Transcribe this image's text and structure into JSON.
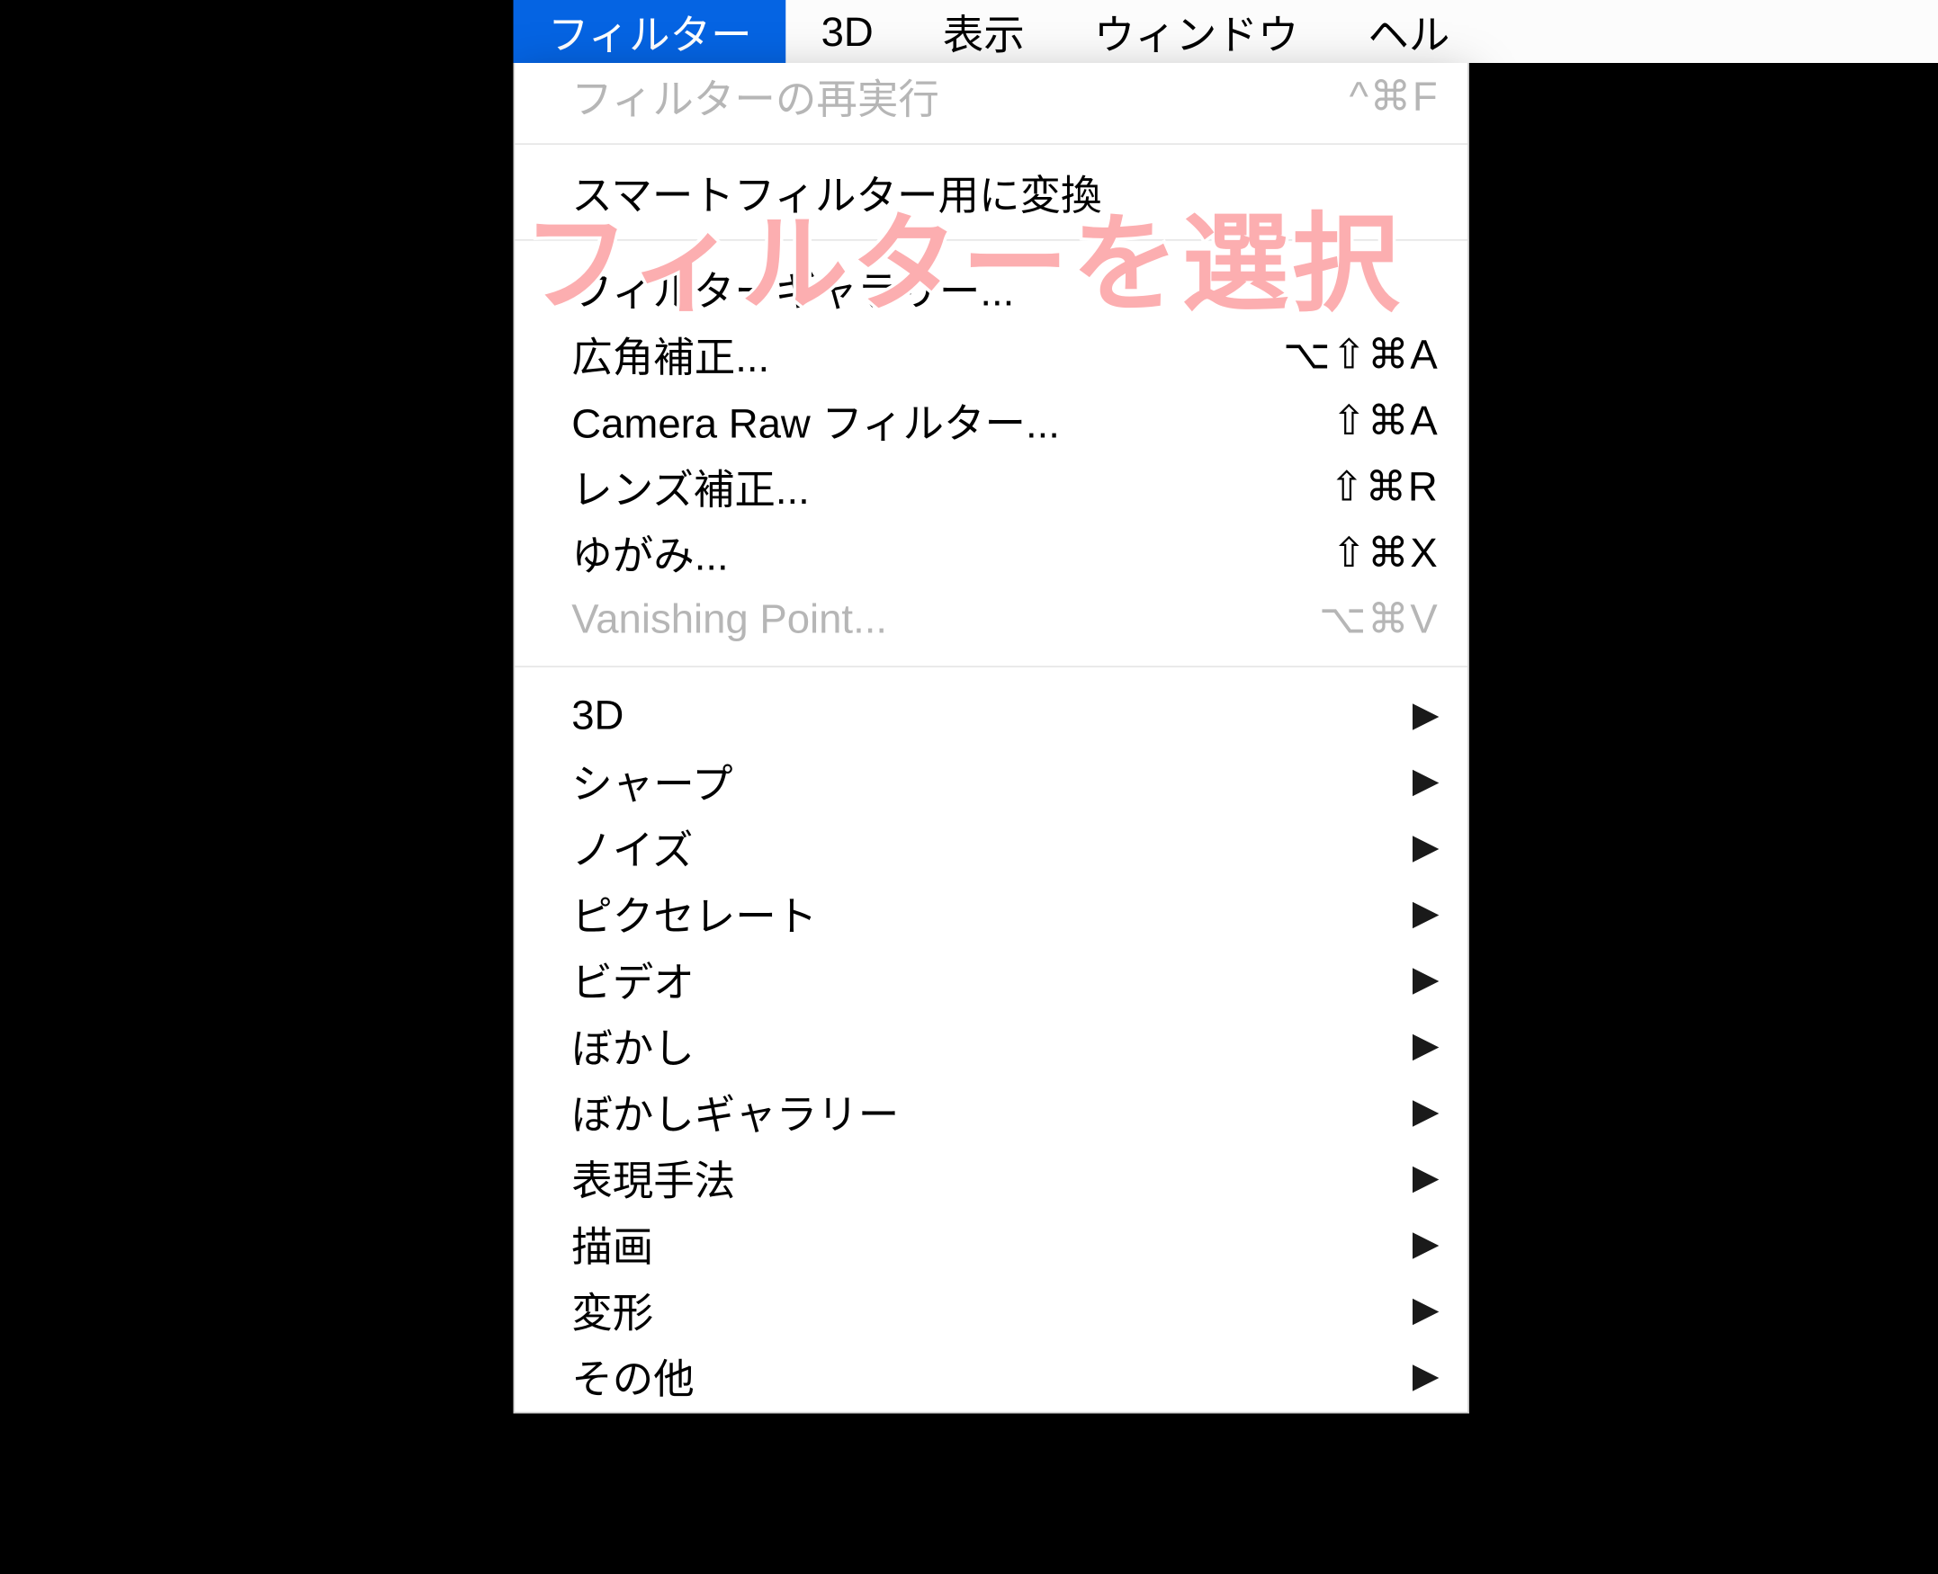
{
  "menubar": {
    "items": [
      {
        "label": "フィルター",
        "active": true
      },
      {
        "label": "3D"
      },
      {
        "label": "表示"
      },
      {
        "label": "ウィンドウ"
      },
      {
        "label": "ヘル"
      }
    ]
  },
  "dropdown": {
    "groups": [
      [
        {
          "label": "フィルターの再実行",
          "shortcut": "^⌘F",
          "disabled": true
        }
      ],
      [
        {
          "label": "スマートフィルター用に変換",
          "disabled": false
        }
      ],
      [
        {
          "label": "フィルターギャラリー...",
          "shortcut": ""
        },
        {
          "label": "広角補正...",
          "shortcut": "⌥⇧⌘A"
        },
        {
          "label": "Camera Raw フィルター...",
          "shortcut": "⇧⌘A"
        },
        {
          "label": "レンズ補正...",
          "shortcut": "⇧⌘R"
        },
        {
          "label": "ゆがみ...",
          "shortcut": "⇧⌘X"
        },
        {
          "label": "Vanishing Point...",
          "shortcut": "⌥⌘V",
          "disabled": true
        }
      ],
      [
        {
          "label": "3D",
          "submenu": true
        },
        {
          "label": "シャープ",
          "submenu": true
        },
        {
          "label": "ノイズ",
          "submenu": true
        },
        {
          "label": "ピクセレート",
          "submenu": true
        },
        {
          "label": "ビデオ",
          "submenu": true
        },
        {
          "label": "ぼかし",
          "submenu": true
        },
        {
          "label": "ぼかしギャラリー",
          "submenu": true
        },
        {
          "label": "表現手法",
          "submenu": true
        },
        {
          "label": "描画",
          "submenu": true
        },
        {
          "label": "変形",
          "submenu": true
        },
        {
          "label": "その他",
          "submenu": true
        }
      ]
    ]
  },
  "annotation": {
    "text": "フィルターを選択"
  }
}
